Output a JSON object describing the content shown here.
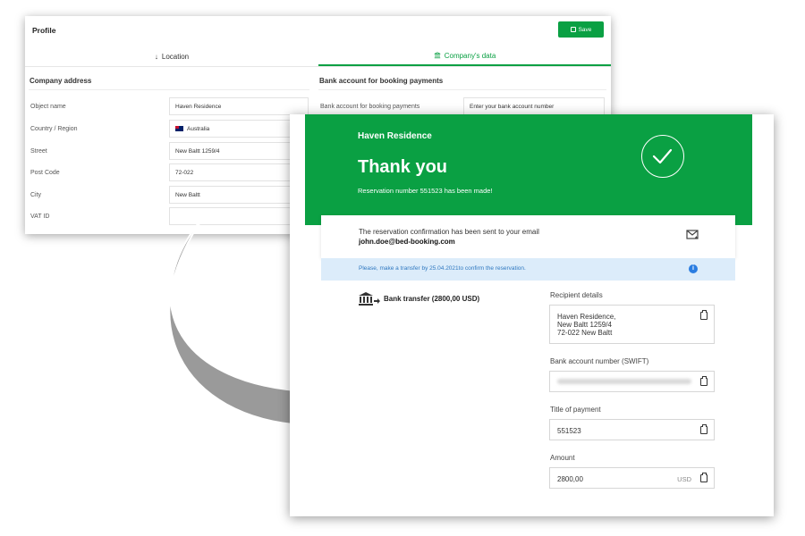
{
  "profile": {
    "title": "Profile",
    "save_label": "Save",
    "tabs": [
      {
        "label": "Location"
      },
      {
        "label": "Company's data"
      }
    ],
    "company_address_heading": "Company address",
    "bank_heading": "Bank account for booking payments",
    "bank_field_label": "Bank account for booking payments",
    "bank_field_placeholder": "Enter your bank account number",
    "fields": [
      {
        "label": "Object name",
        "value": "Haven Residence"
      },
      {
        "label": "Country / Region",
        "value": "Australia"
      },
      {
        "label": "Street",
        "value": "New Baltt 1259/4"
      },
      {
        "label": "Post Code",
        "value": "72-022"
      },
      {
        "label": "City",
        "value": "New Baltt"
      },
      {
        "label": "VAT ID",
        "value": ""
      }
    ]
  },
  "confirmation": {
    "hotel_name": "Haven Residence",
    "thanks": "Thank you",
    "reservation_text": "Reservation number 551523 has been made!",
    "email_message": "The reservation confirmation has been sent to your email",
    "email": "john.doe@bed-booking.com",
    "notice": "Please, make a transfer by 25.04.2021to confirm the reservation.",
    "bank_transfer_title": "Bank transfer (2800,00 USD)",
    "recipient_label": "Recipient details",
    "recipient_value": "Haven Residence,\nNew Baltt 1259/4\n72-022 New Baltt",
    "swift_label": "Bank account number (SWIFT)",
    "payment_title_label": "Title of payment",
    "payment_title_value": "551523",
    "amount_label": "Amount",
    "amount_value": "2800,00",
    "currency": "USD"
  },
  "colors": {
    "brand_green": "#0aa043",
    "notice_bg": "#dcecfa",
    "notice_text": "#2f78c0",
    "arrow_gray": "#9a9a9a"
  }
}
